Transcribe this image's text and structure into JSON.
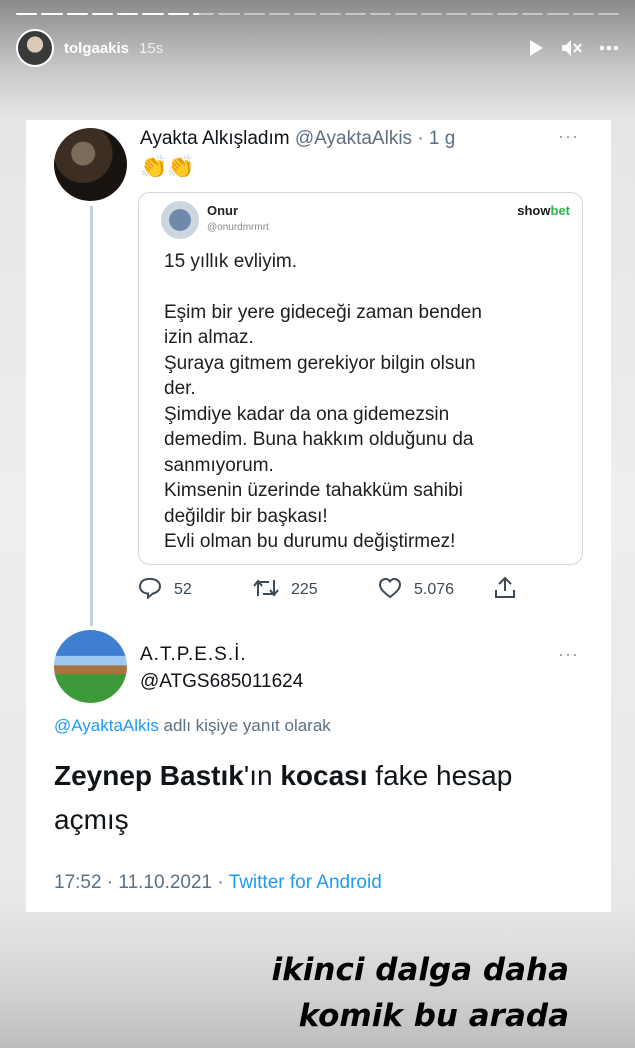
{
  "story": {
    "segments": [
      1,
      1,
      1,
      1,
      1,
      1,
      1,
      0.3,
      0,
      0,
      0,
      0,
      0,
      0,
      0,
      0,
      0,
      0,
      0,
      0,
      0,
      0,
      0,
      0
    ],
    "username": "tolgaakis",
    "time": "15s"
  },
  "tweet": {
    "name": "Ayakta Alkışladım",
    "handle_time": "@AyaktaAlkis · 1 g",
    "emoji": "👏👏",
    "more": "···",
    "quoted": {
      "name": "Onur",
      "handle": "@onurdmrmrt",
      "brand_a": "show",
      "brand_b": "bet",
      "lines": [
        "15 yıllık evliyim.",
        "",
        "Eşim bir yere gideceği zaman benden",
        "izin almaz.",
        "Şuraya gitmem gerekiyor bilgin olsun",
        "der.",
        "Şimdiye kadar da ona gidemezsin",
        "demedim. Buna hakkım olduğunu da",
        "sanmıyorum.",
        "Kimsenin üzerinde tahakküm sahibi",
        "değildir bir başkası!",
        "Evli olman bu durumu değiştirmez!"
      ]
    },
    "replies": "52",
    "retweets": "225",
    "likes": "5.076"
  },
  "reply": {
    "name": "A.T.P.E.S.İ.",
    "handle": "@ATGS685011624",
    "more": "···",
    "reply_link": "@AyaktaAlkis",
    "reply_suffix": " adlı kişiye yanıt olarak",
    "text_parts": [
      "Zeynep Bastık",
      "'ın ",
      "kocası",
      " fake hesap açmış"
    ],
    "meta": "17:52 · 11.10.2021 · ",
    "source": "Twitter for Android"
  },
  "caption": {
    "line1": "ikinci dalga daha",
    "line2": "komik bu arada"
  }
}
